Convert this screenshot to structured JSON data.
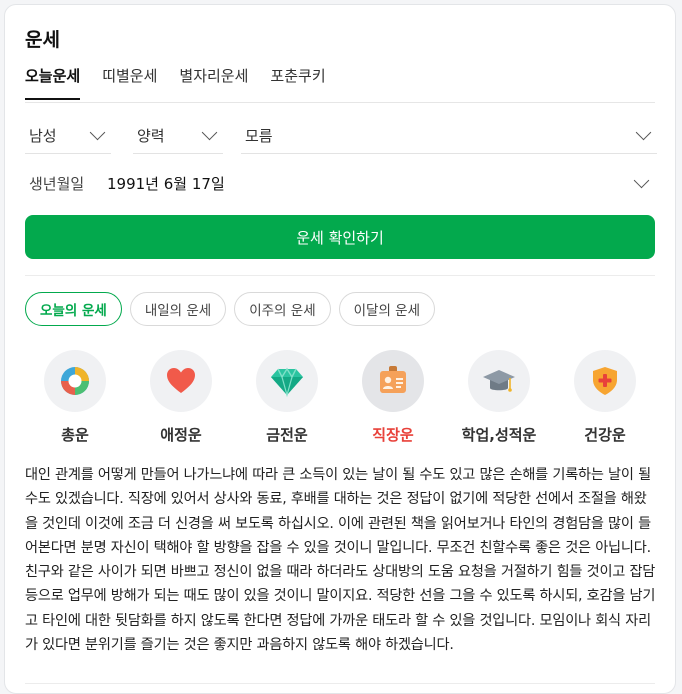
{
  "header": {
    "title": "운세"
  },
  "tabs": [
    {
      "label": "오늘운세",
      "active": true
    },
    {
      "label": "띠별운세"
    },
    {
      "label": "별자리운세"
    },
    {
      "label": "포춘쿠키"
    }
  ],
  "form": {
    "gender": "남성",
    "calendar": "양력",
    "time": "모름",
    "birth_label": "생년월일",
    "birth_value": "1991년 6월 17일",
    "submit_label": "운세 확인하기"
  },
  "periods": [
    {
      "label": "오늘의 운세",
      "active": true
    },
    {
      "label": "내일의 운세"
    },
    {
      "label": "이주의 운세"
    },
    {
      "label": "이달의 운세"
    }
  ],
  "categories": [
    {
      "label": "총운",
      "icon": "pie-chart-icon"
    },
    {
      "label": "애정운",
      "icon": "heart-icon"
    },
    {
      "label": "금전운",
      "icon": "diamond-icon"
    },
    {
      "label": "직장운",
      "icon": "id-badge-icon",
      "active": true
    },
    {
      "label": "학업,성적운",
      "icon": "graduation-cap-icon"
    },
    {
      "label": "건강운",
      "icon": "health-shield-icon"
    }
  ],
  "fortune_text": "대인 관계를 어떻게 만들어 나가느냐에 따라 큰 소득이 있는 날이 될 수도 있고 많은 손해를 기록하는 날이 될 수도 있겠습니다. 직장에 있어서 상사와 동료, 후배를 대하는 것은 정답이 없기에 적당한 선에서 조절을 해왔을 것인데 이것에 조금 더 신경을 써 보도록 하십시오. 이에 관련된 책을 읽어보거나 타인의 경험담을 많이 들어본다면 분명 자신이 택해야 할 방향을 잡을 수 있을 것이니 말입니다. 무조건 친할수록 좋은 것은 아닙니다. 친구와 같은 사이가 되면 바쁘고 정신이 없을 때라 하더라도 상대방의 도움 요청을 거절하기 힘들 것이고 잡담 등으로 업무에 방해가 되는 때도 많이 있을 것이니 말이지요. 적당한 선을 그을 수 있도록 하시되, 호감을 남기고 타인에 대한 뒷담화를 하지 않도록 한다면 정답에 가까운 태도라 할 수 있을 것입니다. 모임이나 회식 자리가 있다면 분위기를 즐기는 것은 좋지만 과음하지 않도록 해야 하겠습니다.",
  "colors": {
    "accent": "#03a94d",
    "active_category": "#e8413a"
  }
}
